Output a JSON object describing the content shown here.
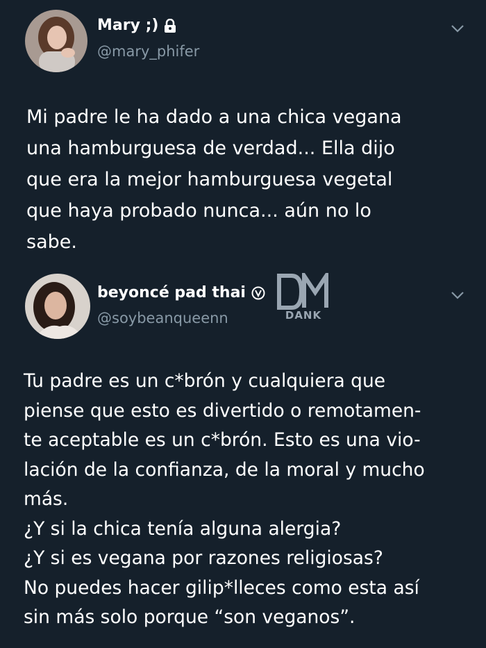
{
  "tweets": [
    {
      "display_name": "Mary ;)",
      "handle": "@mary_phifer",
      "icons": [
        "lock-icon",
        "chevron-down-icon"
      ],
      "lines": [
        "Mi padre le ha dado a una chica vegana",
        "una hamburguesa de verdad... Ella dijo",
        "que era la mejor hamburguesa vegetal",
        "que haya probado nunca... aún no lo",
        "sabe."
      ]
    },
    {
      "display_name": "beyoncé pad thai",
      "handle": "@soybeanqueenn",
      "icons": [
        "verified-icon",
        "chevron-down-icon"
      ],
      "lines": [
        "Tu padre es un c*brón y cualquiera que",
        "piense que esto es divertido o remotamen-",
        "te aceptable es un c*brón. Esto es una vio-",
        "lación de la confianza, de la moral y mucho",
        "más.",
        "¿Y si la chica tenía alguna alergia?",
        "¿Y si es vegana por razones religiosas?",
        "No puedes hacer gilip*lleces como esta así",
        "sin más solo porque “son veganos”."
      ]
    }
  ],
  "watermark": {
    "logo": "DM",
    "text": "DANK"
  },
  "colors": {
    "background": "#15202b",
    "text": "#ffffff",
    "secondary_text": "#8899a6"
  }
}
